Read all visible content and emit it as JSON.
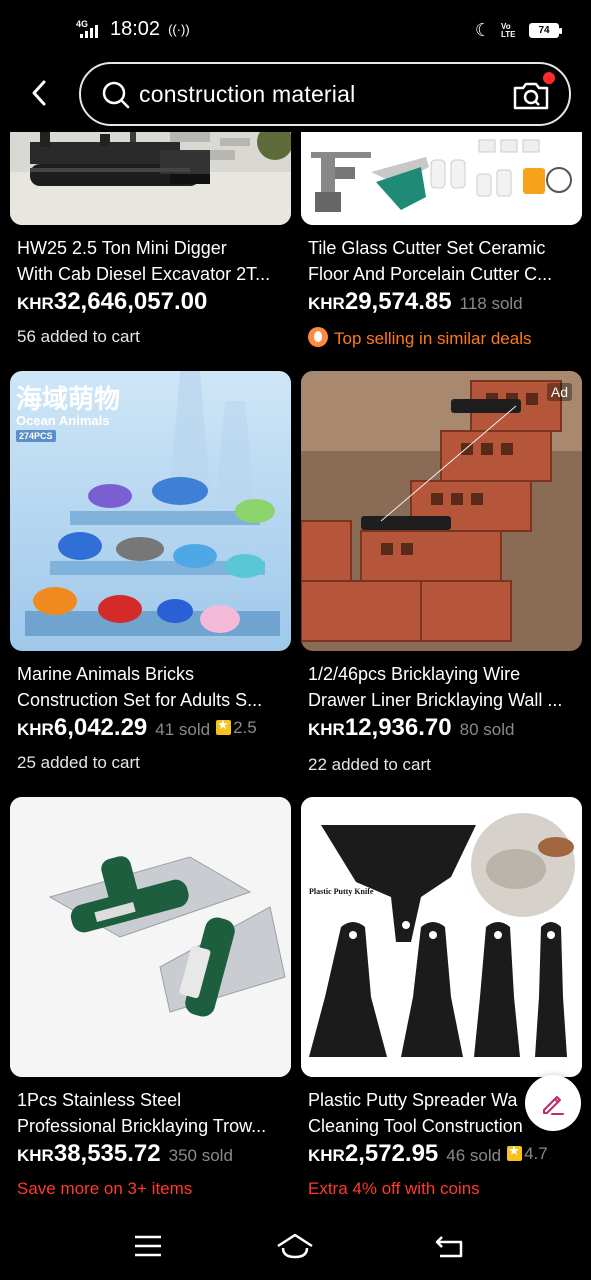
{
  "status_bar": {
    "network": "4G",
    "time": "18:02",
    "volte": "Vo LTE",
    "battery": "74"
  },
  "search": {
    "query": "construction material"
  },
  "products": [
    {
      "title_line1": "HW25 2.5 Ton Mini Digger",
      "title_line2": "With Cab Diesel Excavator 2T...",
      "currency": "KHR",
      "price": "32,646,057.00",
      "sold": "",
      "rating": "",
      "extra": "56 added to cart"
    },
    {
      "title_line1": "Tile Glass Cutter Set Ceramic",
      "title_line2": "Floor And Porcelain Cutter C...",
      "currency": "KHR",
      "price": "29,574.85",
      "sold": "118 sold",
      "rating": "",
      "extra": "Top selling in similar deals"
    },
    {
      "title_line1": "Marine Animals Bricks",
      "title_line2": "Construction Set for Adults S...",
      "currency": "KHR",
      "price": "6,042.29",
      "sold": "41 sold",
      "rating": "2.5",
      "extra": "25 added to cart",
      "image_text_cn": "海域萌物",
      "image_text_en": "Ocean Animals",
      "image_text_pcs": "274PCS"
    },
    {
      "title_line1": "1/2/46pcs Bricklaying Wire",
      "title_line2": "Drawer Liner Bricklaying Wall ...",
      "currency": "KHR",
      "price": "12,936.70",
      "sold": "80 sold",
      "rating": "",
      "extra": "22 added to cart",
      "ad": "Ad"
    },
    {
      "title_line1": "1Pcs Stainless Steel",
      "title_line2": "Professional Bricklaying Trow...",
      "currency": "KHR",
      "price": "38,535.72",
      "sold": "350 sold",
      "rating": "",
      "extra": "Save more on 3+ items"
    },
    {
      "title_line1": "Plastic Putty Spreader Wa",
      "title_line2": "Cleaning Tool Construction",
      "currency": "KHR",
      "price": "2,572.95",
      "sold": "46 sold",
      "rating": "4.7",
      "extra": "Extra 4% off with coins",
      "image_text": "Plastic Putty Knife"
    }
  ],
  "icons": {
    "back": "back-arrow-icon",
    "search": "search-icon",
    "camera": "camera-search-icon",
    "edit": "edit-pencil-icon",
    "menu": "menu-icon",
    "home": "home-icon",
    "return": "back-nav-icon"
  },
  "colors": {
    "background": "#000000",
    "promo_red": "#ff3b30",
    "promo_orange": "#ff7a1a",
    "sold_gray": "#8a8a8a",
    "star_yellow": "#f7c21b"
  }
}
